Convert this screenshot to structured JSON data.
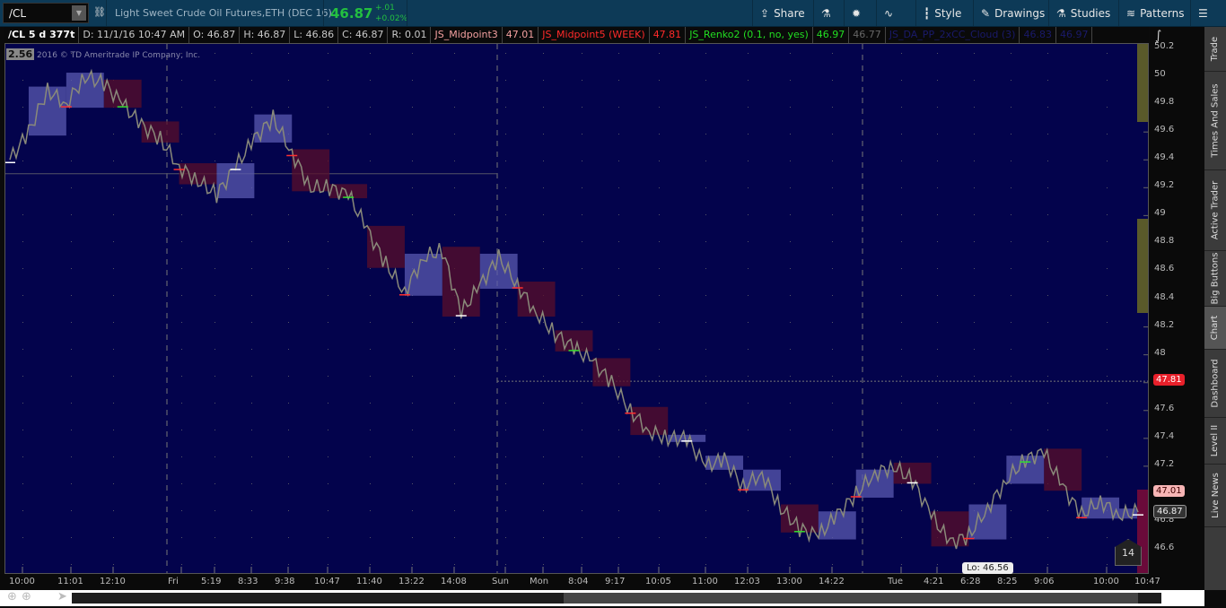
{
  "toolbar": {
    "symbol": "/CL",
    "description": "Light Sweet Crude Oil Futures,ETH (DEC 16)",
    "last": "46.87",
    "net_change": "+.01",
    "pct_change": "+0.02%",
    "buttons": [
      {
        "label": "Share",
        "icon": "share-icon"
      },
      {
        "label": "",
        "icon": "flask-icon"
      },
      {
        "label": "",
        "icon": "gear-icon"
      },
      {
        "label": "",
        "icon": "pulse-icon"
      },
      {
        "label": "Style",
        "icon": "candlestick-icon"
      },
      {
        "label": "Drawings",
        "icon": "pencil-icon"
      },
      {
        "label": "Studies",
        "icon": "flask-icon"
      },
      {
        "label": "Patterns",
        "icon": "patterns-icon"
      },
      {
        "label": "",
        "icon": "menu-icon"
      }
    ]
  },
  "infobar": [
    {
      "text": "/CL 5 d 377t",
      "color": "#ffffff"
    },
    {
      "text": "D: 11/1/16 10:47 AM",
      "color": "#c8c8c8"
    },
    {
      "text": "O: 46.87",
      "color": "#c8c8c8"
    },
    {
      "text": "H: 46.87",
      "color": "#c8c8c8"
    },
    {
      "text": "L: 46.86",
      "color": "#c8c8c8"
    },
    {
      "text": "C: 46.87",
      "color": "#c8c8c8"
    },
    {
      "text": "R: 0.01",
      "color": "#c8c8c8"
    },
    {
      "text": "JS_Midpoint3",
      "color": "#f4a0a0"
    },
    {
      "text": "47.01",
      "color": "#f4a0a0"
    },
    {
      "text": "JS_Midpoint5 (WEEK)",
      "color": "#ff2a2a"
    },
    {
      "text": "47.81",
      "color": "#ff2a2a"
    },
    {
      "text": "JS_Renko2 (0.1, no, yes)",
      "color": "#22dd22"
    },
    {
      "text": "46.97",
      "color": "#22dd22"
    },
    {
      "text": "46.77",
      "color": "#666666"
    },
    {
      "text": "JS_DA_PP_2xCC_Cloud (3)",
      "color": "#1a1a6a"
    },
    {
      "text": "46.83",
      "color": "#1a1a6a"
    },
    {
      "text": "46.97",
      "color": "#1a1a6a"
    }
  ],
  "chart": {
    "copyright": "2016 © TD Ameritrade IP Company, Inc.",
    "badge": "2.56",
    "low_label": "Lo: 46.56",
    "bubble": "14"
  },
  "price_labels": [
    {
      "text": "47.81",
      "price": 47.81,
      "bg": "#e8202a",
      "fg": "#ffffff"
    },
    {
      "text": "47.01",
      "price": 47.01,
      "bg": "#f7b5b5",
      "fg": "#400000"
    },
    {
      "text": "46.87",
      "price": 46.87,
      "bg": "#333333",
      "fg": "#eeeeee"
    }
  ],
  "sidebar": [
    "Trade",
    "Times And Sales",
    "Active Trader",
    "Big Buttons",
    "Chart",
    "Dashboard",
    "Level II",
    "Live News"
  ],
  "chart_data": {
    "type": "line",
    "ylim": [
      46.45,
      50.3
    ],
    "yticks": [
      "50.2",
      "50",
      "49.8",
      "49.6",
      "49.4",
      "49.2",
      "49",
      "48.8",
      "48.6",
      "48.4",
      "48.2",
      "48",
      "47.8",
      "47.6",
      "47.4",
      "47.2",
      "47",
      "46.8",
      "46.6"
    ],
    "xticks": [
      "10:00",
      "11:01",
      "12:10",
      "Fri",
      "5:19",
      "8:33",
      "9:38",
      "10:47",
      "11:40",
      "13:22",
      "14:08",
      "Sun",
      "Mon",
      "8:04",
      "9:17",
      "10:05",
      "11:00",
      "12:03",
      "13:00",
      "14:22",
      "Tue",
      "4:21",
      "6:28",
      "8:25",
      "9:06",
      "10:00",
      "10:47"
    ],
    "session_breaks": [
      "Fri",
      "Sun",
      "Tue"
    ],
    "reference_lines": [
      47.81
    ],
    "values": [
      49.4,
      49.6,
      49.9,
      49.8,
      50.0,
      49.95,
      49.8,
      49.65,
      49.55,
      49.35,
      49.25,
      49.15,
      49.35,
      49.55,
      49.7,
      49.45,
      49.2,
      49.2,
      49.15,
      48.9,
      48.65,
      48.45,
      48.7,
      48.75,
      48.3,
      48.5,
      48.7,
      48.5,
      48.3,
      48.15,
      48.05,
      47.95,
      47.8,
      47.6,
      47.45,
      47.4,
      47.4,
      47.2,
      47.25,
      47.05,
      47.15,
      46.9,
      46.75,
      46.7,
      46.85,
      47.0,
      47.15,
      47.2,
      47.1,
      46.85,
      46.65,
      46.7,
      46.9,
      47.1,
      47.25,
      47.3,
      47.05,
      46.85,
      46.95,
      46.85,
      46.87
    ],
    "colors": {
      "line": "#8a8a7a",
      "up_box": "#5a5ab0",
      "down_box": "#5a0f2a",
      "background": "#03034c"
    }
  }
}
